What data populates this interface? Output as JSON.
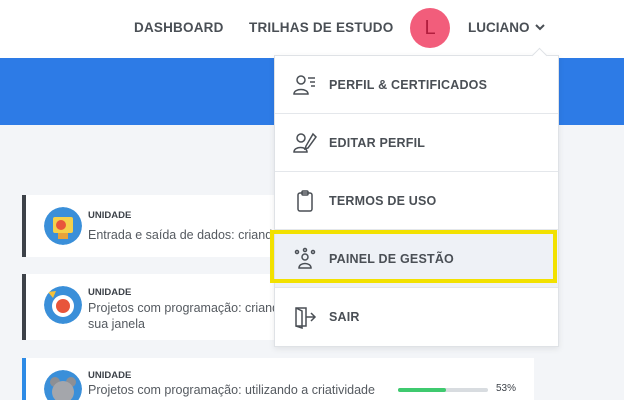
{
  "nav": {
    "dashboard": "DASHBOARD",
    "trilhas": "TRILHAS DE ESTUDO",
    "avatar_letter": "L",
    "user_name": "LUCIANO"
  },
  "menu": {
    "items": [
      {
        "label": "PERFIL & CERTIFICADOS",
        "icon": "profile-certificates-icon"
      },
      {
        "label": "EDITAR PERFIL",
        "icon": "edit-profile-icon"
      },
      {
        "label": "TERMOS DE USO",
        "icon": "clipboard-icon"
      },
      {
        "label": "PAINEL DE GESTÃO",
        "icon": "management-panel-icon"
      },
      {
        "label": "SAIR",
        "icon": "logout-icon"
      }
    ],
    "highlighted_item": "PAINEL DE GESTÃO"
  },
  "cards": [
    {
      "label": "UNIDADE",
      "title": "Entrada e saída de dados: criando"
    },
    {
      "label": "UNIDADE",
      "title_line1": "Projetos com programação: criand",
      "title_line2": "sua janela"
    },
    {
      "label": "UNIDADE",
      "title": "Projetos com programação: utilizando a criatividade",
      "progress": 53,
      "progress_text": "53%"
    }
  ],
  "colors": {
    "banner": "#2d7be6",
    "avatar": "#f25d7b",
    "highlight_border": "#f2e100",
    "progress": "#3fca6f"
  }
}
